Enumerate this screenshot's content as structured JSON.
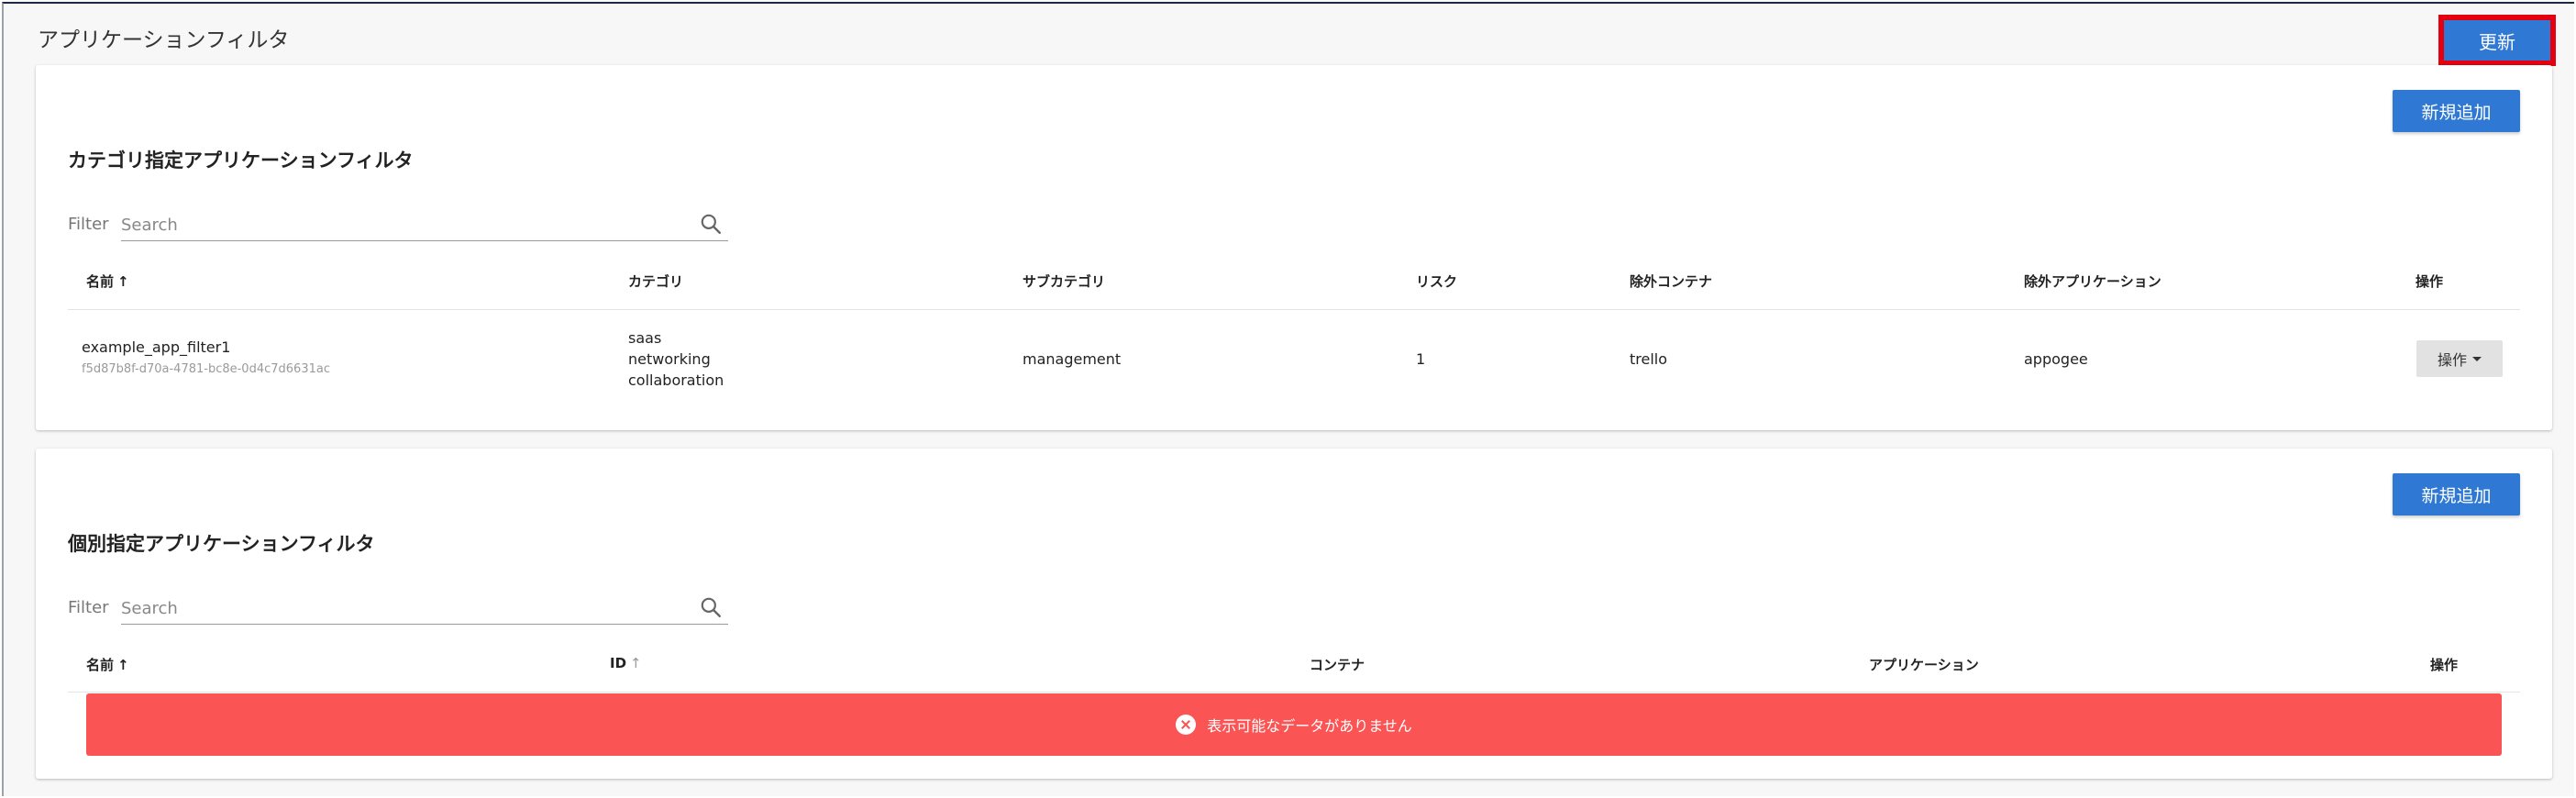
{
  "page": {
    "title": "アプリケーションフィルタ",
    "refresh_label": "更新"
  },
  "category_filter": {
    "title": "カテゴリ指定アプリケーションフィルタ",
    "add_label": "新規追加",
    "filter_label": "Filter",
    "search_placeholder": "Search",
    "columns": {
      "name": "名前",
      "category": "カテゴリ",
      "subcategory": "サブカテゴリ",
      "risk": "リスク",
      "excluded_container": "除外コンテナ",
      "excluded_app": "除外アプリケーション",
      "ops": "操作"
    },
    "sort_arrow": "↑",
    "rows": [
      {
        "name": "example_app_filter1",
        "id": "f5d87b8f-d70a-4781-bc8e-0d4c7d6631ac",
        "categories": [
          "saas",
          "networking",
          "collaboration"
        ],
        "subcategory": "management",
        "risk": "1",
        "excluded_container": "trello",
        "excluded_app": "appogee",
        "ops_label": "操作"
      }
    ]
  },
  "individual_filter": {
    "title": "個別指定アプリケーションフィルタ",
    "add_label": "新規追加",
    "filter_label": "Filter",
    "search_placeholder": "Search",
    "columns": {
      "name": "名前",
      "id": "ID",
      "container": "コンテナ",
      "application": "アプリケーション",
      "ops": "操作"
    },
    "sort_arrow": "↑",
    "empty_message": "表示可能なデータがありません"
  },
  "colors": {
    "primary": "#2f79d4",
    "highlight_border": "#e4000f",
    "empty_alert": "#fb5454"
  },
  "icons": {
    "search": "search-icon",
    "caret": "caret-down-icon",
    "error": "error-circle-icon"
  }
}
